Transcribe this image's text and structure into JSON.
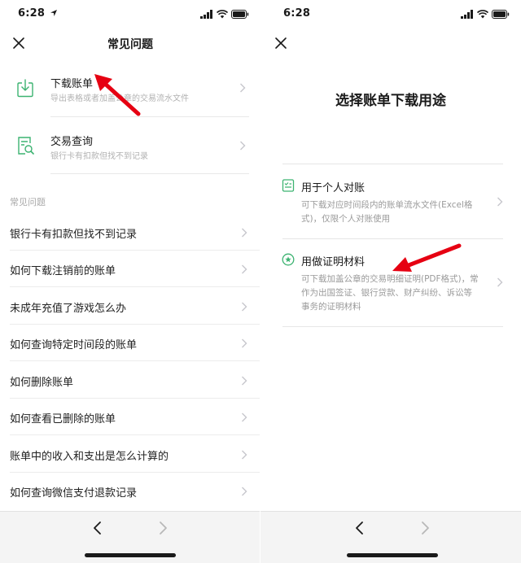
{
  "left": {
    "status_time": "6:28",
    "nav_title": "常见问题",
    "top_items": [
      {
        "title": "下载账单",
        "subtitle": "导出表格或者加盖公章的交易流水文件"
      },
      {
        "title": "交易查询",
        "subtitle": "银行卡有扣款但找不到记录"
      }
    ],
    "section_label": "常见问题",
    "faq": [
      "银行卡有扣款但找不到记录",
      "如何下载注销前的账单",
      "未成年充值了游戏怎么办",
      "如何查询特定时间段的账单",
      "如何删除账单",
      "如何查看已删除的账单",
      "账单中的收入和支出是怎么计算的",
      "如何查询微信支付退款记录"
    ]
  },
  "right": {
    "status_time": "6:28",
    "title": "选择账单下载用途",
    "options": [
      {
        "title": "用于个人对账",
        "desc": "可下载对应时间段内的账单流水文件(Excel格式)，仅限个人对账使用"
      },
      {
        "title": "用做证明材料",
        "desc": "可下载加盖公章的交易明细证明(PDF格式)，常作为出国签证、银行贷款、财产纠纷、诉讼等事务的证明材料"
      }
    ]
  },
  "colors": {
    "accent_green": "#3cb371",
    "annotation_red": "#e60012",
    "chevron_gray": "#c7c7cc"
  },
  "icons": {
    "close": "close-icon",
    "download": "download-icon",
    "search_doc": "search-document-icon",
    "checklist": "checklist-document-icon",
    "star_badge": "star-badge-icon",
    "chevron": "chevron-right-icon",
    "back": "back-arrow-icon",
    "forward": "forward-arrow-icon"
  }
}
